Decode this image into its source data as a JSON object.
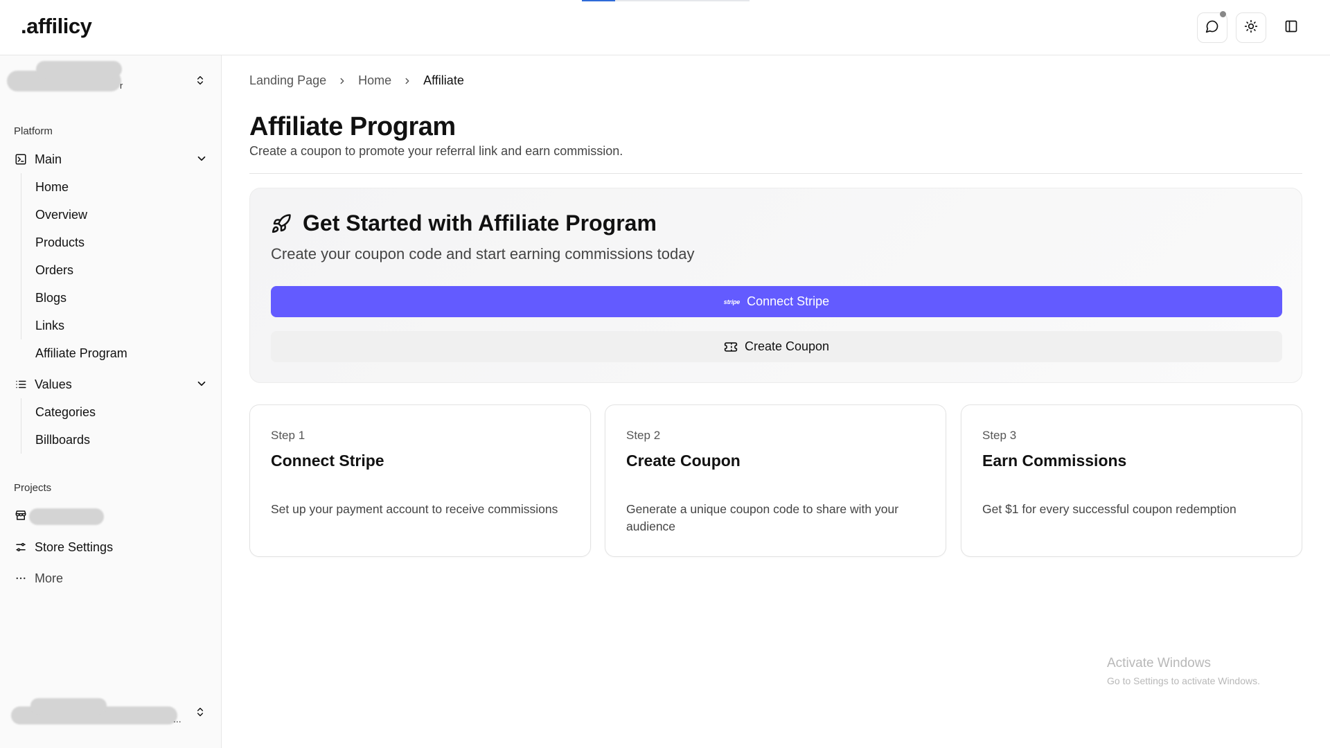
{
  "app": {
    "logo": ".affilicy",
    "loading_progress": 0.2
  },
  "header": {
    "icons": [
      "message-icon",
      "sun-icon",
      "sidebar-toggle-icon"
    ]
  },
  "sidebar": {
    "team_suffix": "r",
    "platform_label": "Platform",
    "main_group": {
      "label": "Main",
      "items": [
        "Home",
        "Overview",
        "Products",
        "Orders",
        "Blogs",
        "Links",
        "Affiliate Program"
      ]
    },
    "values_group": {
      "label": "Values",
      "items": [
        "Categories",
        "Billboards"
      ]
    },
    "projects_label": "Projects",
    "store_settings": "Store Settings",
    "more": "More",
    "user_suffix": "..."
  },
  "breadcrumb": [
    "Landing Page",
    "Home",
    "Affiliate"
  ],
  "page": {
    "title": "Affiliate Program",
    "subtitle": "Create a coupon to promote your referral link and earn commission."
  },
  "hero": {
    "title": "Get Started with Affiliate Program",
    "subtitle": "Create your coupon code and start earning commissions today",
    "stripe_mark": "stripe",
    "connect_label": "Connect Stripe",
    "coupon_label": "Create Coupon",
    "accent": "#635bff"
  },
  "steps": [
    {
      "number": "Step 1",
      "title": "Connect Stripe",
      "description": "Set up your payment account to receive commissions"
    },
    {
      "number": "Step 2",
      "title": "Create Coupon",
      "description": "Generate a unique coupon code to share with your audience"
    },
    {
      "number": "Step 3",
      "title": "Earn Commissions",
      "description": "Get $1 for every successful coupon redemption"
    }
  ],
  "watermark": {
    "line1": "Activate Windows",
    "line2": "Go to Settings to activate Windows."
  }
}
